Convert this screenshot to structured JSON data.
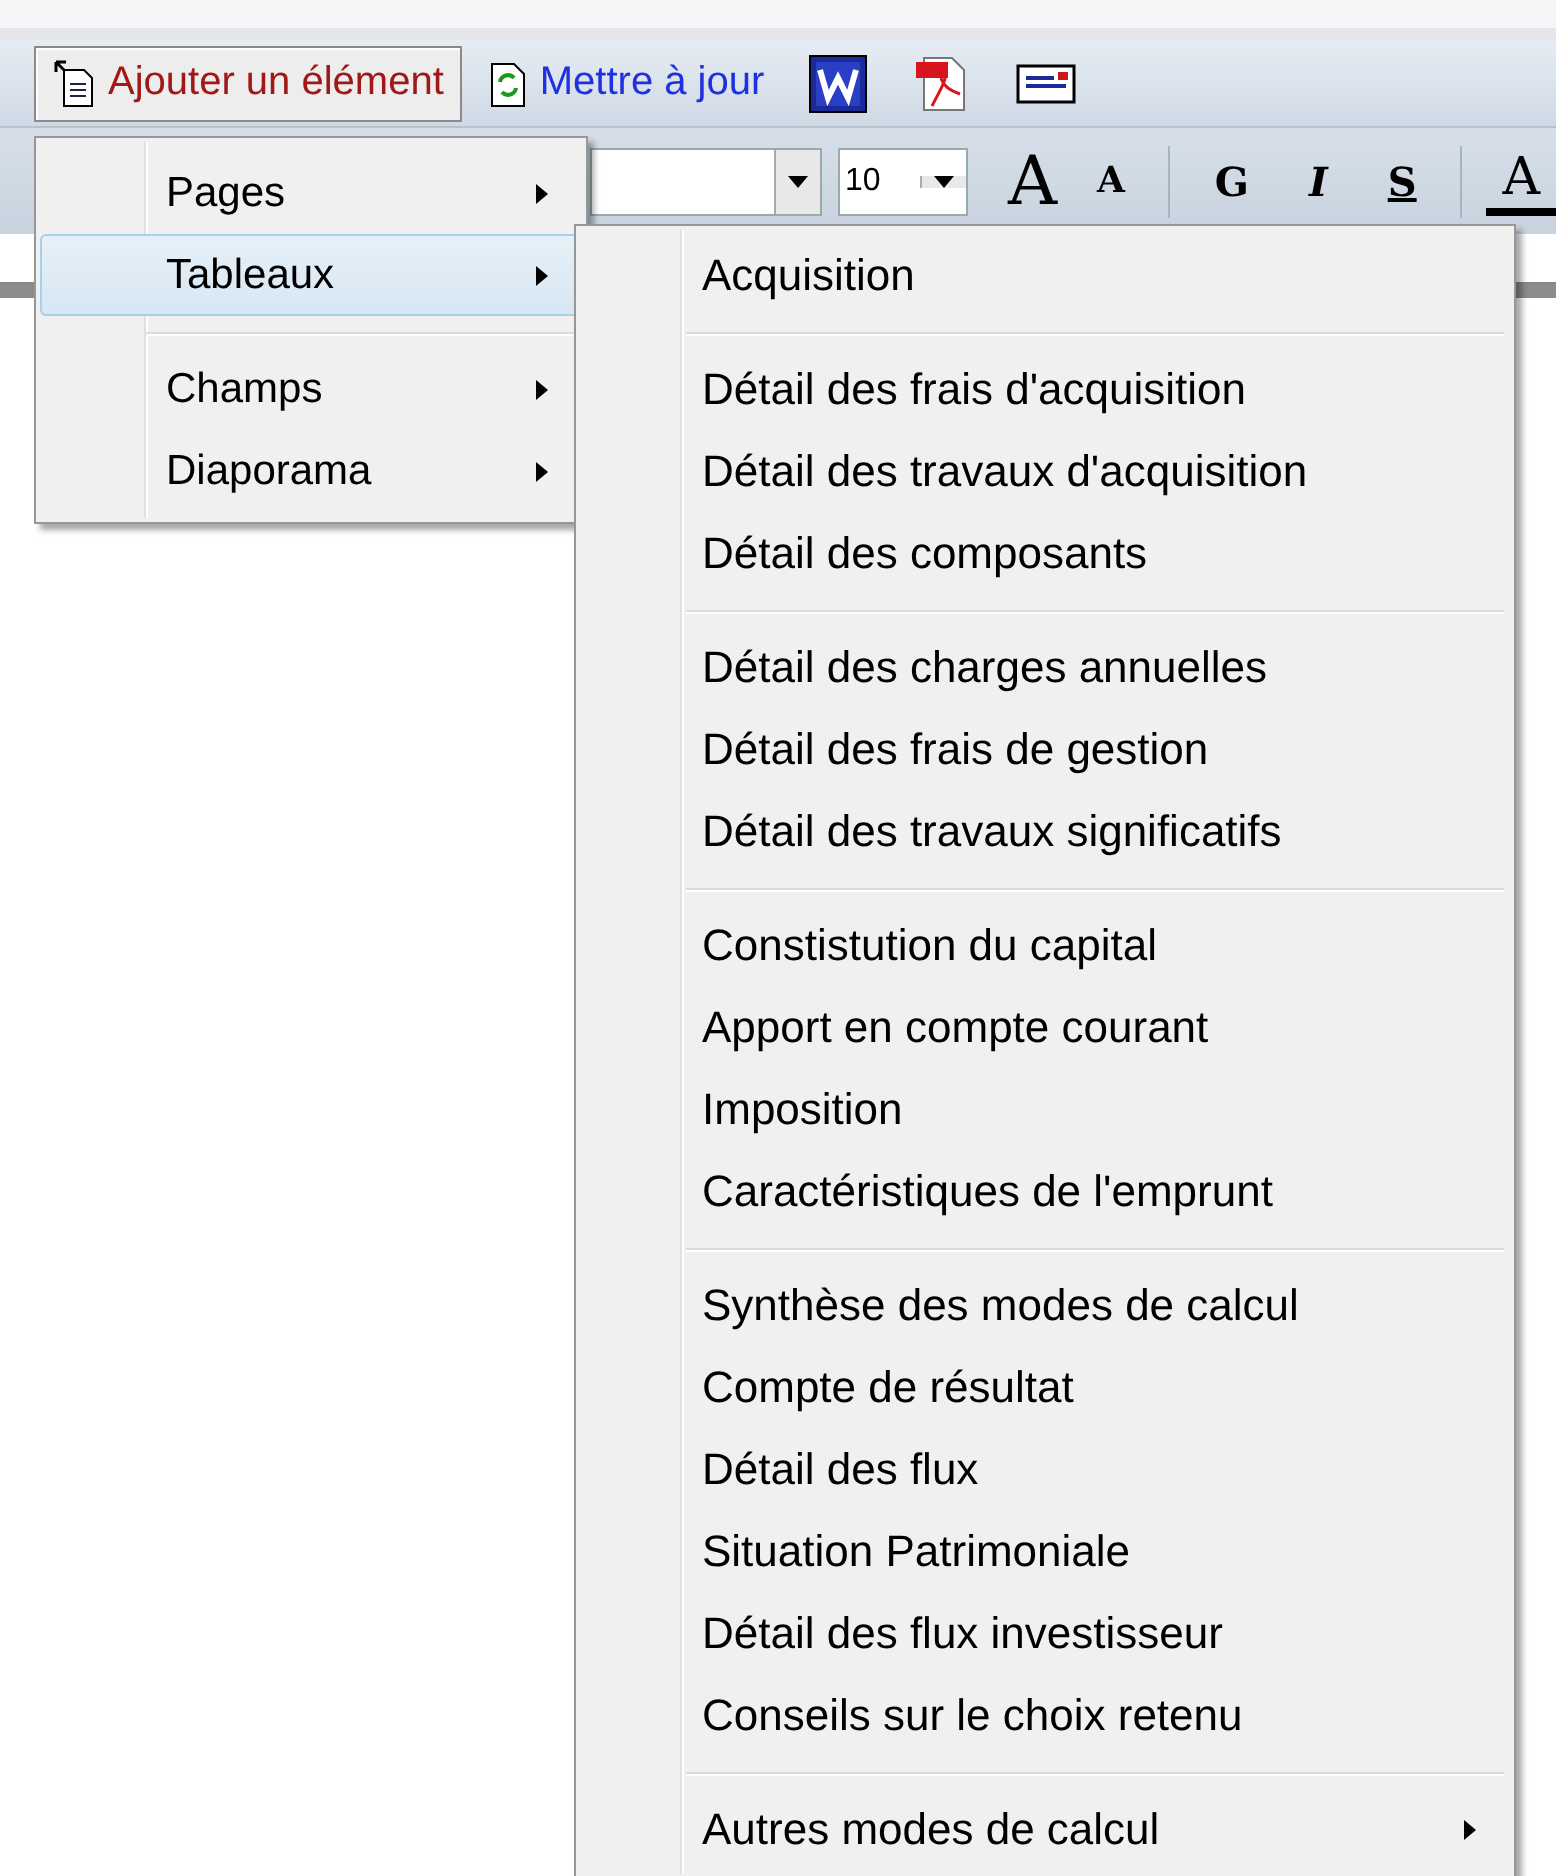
{
  "toolbar": [
    {
      "kind": "add",
      "label": "Ajouter un élément",
      "pressed": true
    },
    {
      "kind": "refresh",
      "label": "Mettre à jour",
      "pressed": false
    },
    {
      "kind": "word",
      "pressed": false
    },
    {
      "kind": "pdf",
      "pressed": false
    },
    {
      "kind": "mail",
      "pressed": false
    }
  ],
  "format_bar": {
    "font_size": "10",
    "buttons": [
      {
        "kind": "grow",
        "label": "A"
      },
      {
        "kind": "shrink",
        "label": "A"
      },
      {
        "kind": "sep"
      },
      {
        "kind": "bold",
        "label": "G"
      },
      {
        "kind": "italic",
        "label": "I"
      },
      {
        "kind": "underline",
        "label": "S"
      },
      {
        "kind": "sep"
      },
      {
        "kind": "color",
        "label": "A"
      }
    ]
  },
  "menu": {
    "items": [
      {
        "label": "Pages",
        "selected": false,
        "separator_before": false,
        "has_submenu": true
      },
      {
        "label": "Tableaux",
        "selected": true,
        "separator_before": false,
        "has_submenu": true
      },
      {
        "label": "Champs",
        "selected": false,
        "separator_before": true,
        "has_submenu": true
      },
      {
        "label": "Diaporama",
        "selected": false,
        "separator_before": false,
        "has_submenu": true
      }
    ]
  },
  "submenu": {
    "items": [
      {
        "label": "Acquisition",
        "separator_before": false,
        "has_submenu": false
      },
      {
        "label": "Détail des frais d'acquisition",
        "separator_before": true,
        "has_submenu": false
      },
      {
        "label": "Détail des travaux d'acquisition",
        "separator_before": false,
        "has_submenu": false
      },
      {
        "label": "Détail des composants",
        "separator_before": false,
        "has_submenu": false
      },
      {
        "label": "Détail des charges annuelles",
        "separator_before": true,
        "has_submenu": false
      },
      {
        "label": "Détail des frais de gestion",
        "separator_before": false,
        "has_submenu": false
      },
      {
        "label": "Détail des travaux significatifs",
        "separator_before": false,
        "has_submenu": false
      },
      {
        "label": "Constistution du capital",
        "separator_before": true,
        "has_submenu": false
      },
      {
        "label": "Apport en compte courant",
        "separator_before": false,
        "has_submenu": false
      },
      {
        "label": "Imposition",
        "separator_before": false,
        "has_submenu": false
      },
      {
        "label": "Caractéristiques de l'emprunt",
        "separator_before": false,
        "has_submenu": false
      },
      {
        "label": "Synthèse des modes de calcul",
        "separator_before": true,
        "has_submenu": false
      },
      {
        "label": "Compte de résultat",
        "separator_before": false,
        "has_submenu": false
      },
      {
        "label": "Détail des flux",
        "separator_before": false,
        "has_submenu": false
      },
      {
        "label": "Situation Patrimoniale",
        "separator_before": false,
        "has_submenu": false
      },
      {
        "label": "Détail des flux investisseur",
        "separator_before": false,
        "has_submenu": false
      },
      {
        "label": "Conseils sur le choix retenu",
        "separator_before": false,
        "has_submenu": false
      },
      {
        "label": "Autres modes de calcul",
        "separator_before": true,
        "has_submenu": true
      }
    ]
  }
}
